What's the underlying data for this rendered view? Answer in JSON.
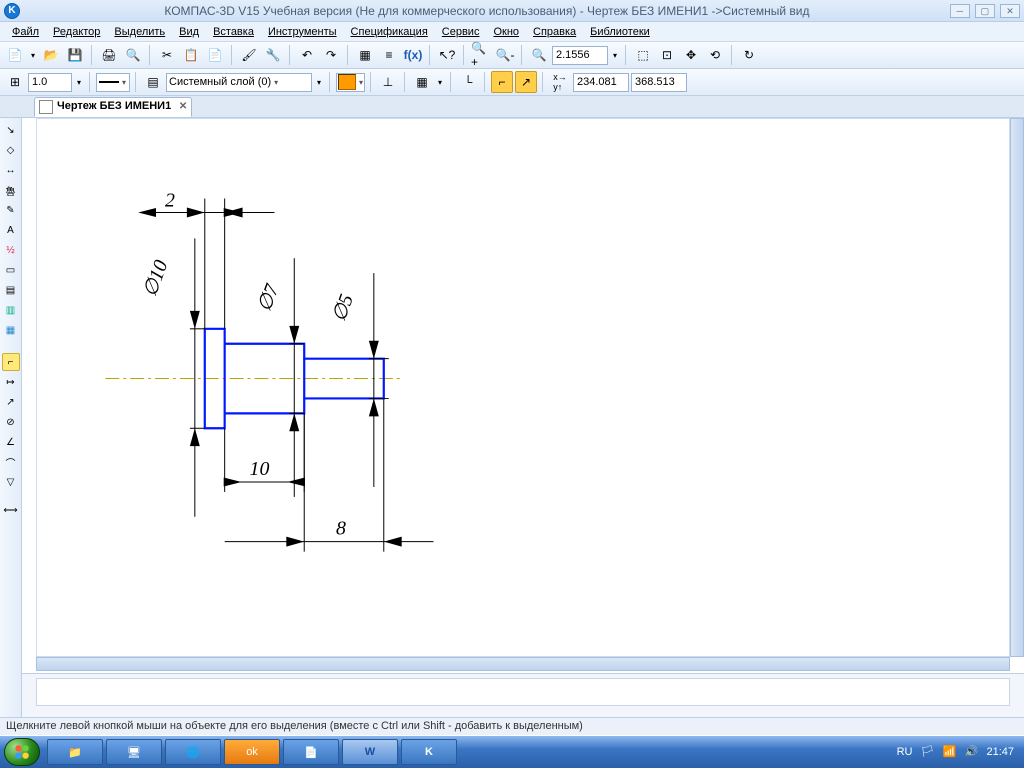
{
  "window": {
    "title": "КОМПАС-3D V15 Учебная версия (Не для коммерческого использования) - Чертеж БЕЗ ИМЕНИ1 ->Системный вид",
    "logo_letter": "K"
  },
  "menu": {
    "file": "Файл",
    "editor": "Редактор",
    "select": "Выделить",
    "view": "Вид",
    "insert": "Вставка",
    "tools": "Инструменты",
    "spec": "Спецификация",
    "service": "Сервис",
    "window": "Окно",
    "help": "Справка",
    "libraries": "Библиотеки"
  },
  "toolbar1": {
    "zoom_value": "2.1556"
  },
  "toolbar2": {
    "line_weight": "1.0",
    "layer_name": "Системный слой (0)",
    "coord_x": "234.081",
    "coord_y": "368.513"
  },
  "tab": {
    "name": "Чертеж БЕЗ ИМЕНИ1"
  },
  "statusbar": {
    "hint": "Щелкните левой кнопкой мыши на объекте для его выделения (вместе с Ctrl или Shift - добавить к выделенным)"
  },
  "taskbar": {
    "lang": "RU",
    "clock": "21:47"
  },
  "drawing": {
    "dim_width_flange": "2",
    "dia_flange": "∅10",
    "dia_mid": "∅7",
    "dia_tip": "∅5",
    "dim_mid": "10",
    "dim_tip": "8"
  }
}
